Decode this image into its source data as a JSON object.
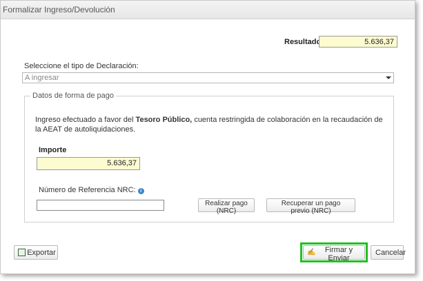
{
  "window": {
    "title": "Formalizar Ingreso/Devolución"
  },
  "resultado": {
    "label": "Resultado",
    "value": "5.636,37"
  },
  "declaracion": {
    "label": "Seleccione el tipo de Declaración:",
    "selected": "A ingresar"
  },
  "pago": {
    "legend": "Datos de forma de pago",
    "desc_prefix": "Ingreso efectuado a favor del",
    "desc_bold": "Tesoro Público,",
    "desc_suffix": "cuenta restringida de colaboración en la recaudación de la AEAT de autoliquidaciones.",
    "importe_label": "Importe",
    "importe_value": "5.636,37",
    "nrc_label": "Número de Referencia NRC:",
    "nrc_value": "",
    "realizar_label": "Realizar pago (NRC)",
    "recuperar_label": "Recuperar un pago previo (NRC)"
  },
  "footer": {
    "exportar_label": "Exportar",
    "firmar_label": "Firmar y Enviar",
    "cancelar_label": "Cancelar"
  },
  "icons": [
    "chevron-down-icon",
    "info-icon",
    "export-icon",
    "sign-icon"
  ],
  "colors": {
    "highlight_field": "#fdfbd0",
    "focus_ring": "#22c022",
    "info_blue": "#3a86c8"
  }
}
